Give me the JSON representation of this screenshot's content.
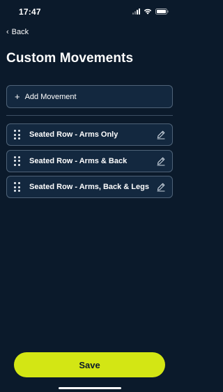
{
  "status_bar": {
    "time": "17:47"
  },
  "nav": {
    "back_label": "Back",
    "back_chevron": "‹"
  },
  "header": {
    "title": "Custom Movements"
  },
  "add_movement": {
    "icon": "+",
    "label": "Add Movement"
  },
  "movements": [
    {
      "name": "Seated Row - Arms Only"
    },
    {
      "name": "Seated Row - Arms & Back"
    },
    {
      "name": "Seated Row - Arms, Back & Legs"
    }
  ],
  "footer": {
    "save_label": "Save"
  },
  "colors": {
    "background": "#0b1a2b",
    "card": "#13283f",
    "card_border": "#4f6378",
    "accent": "#d3e614"
  },
  "icons": {
    "back": "chevron-left-icon",
    "add": "plus-icon",
    "drag": "drag-handle-icon",
    "edit": "pencil-icon"
  }
}
